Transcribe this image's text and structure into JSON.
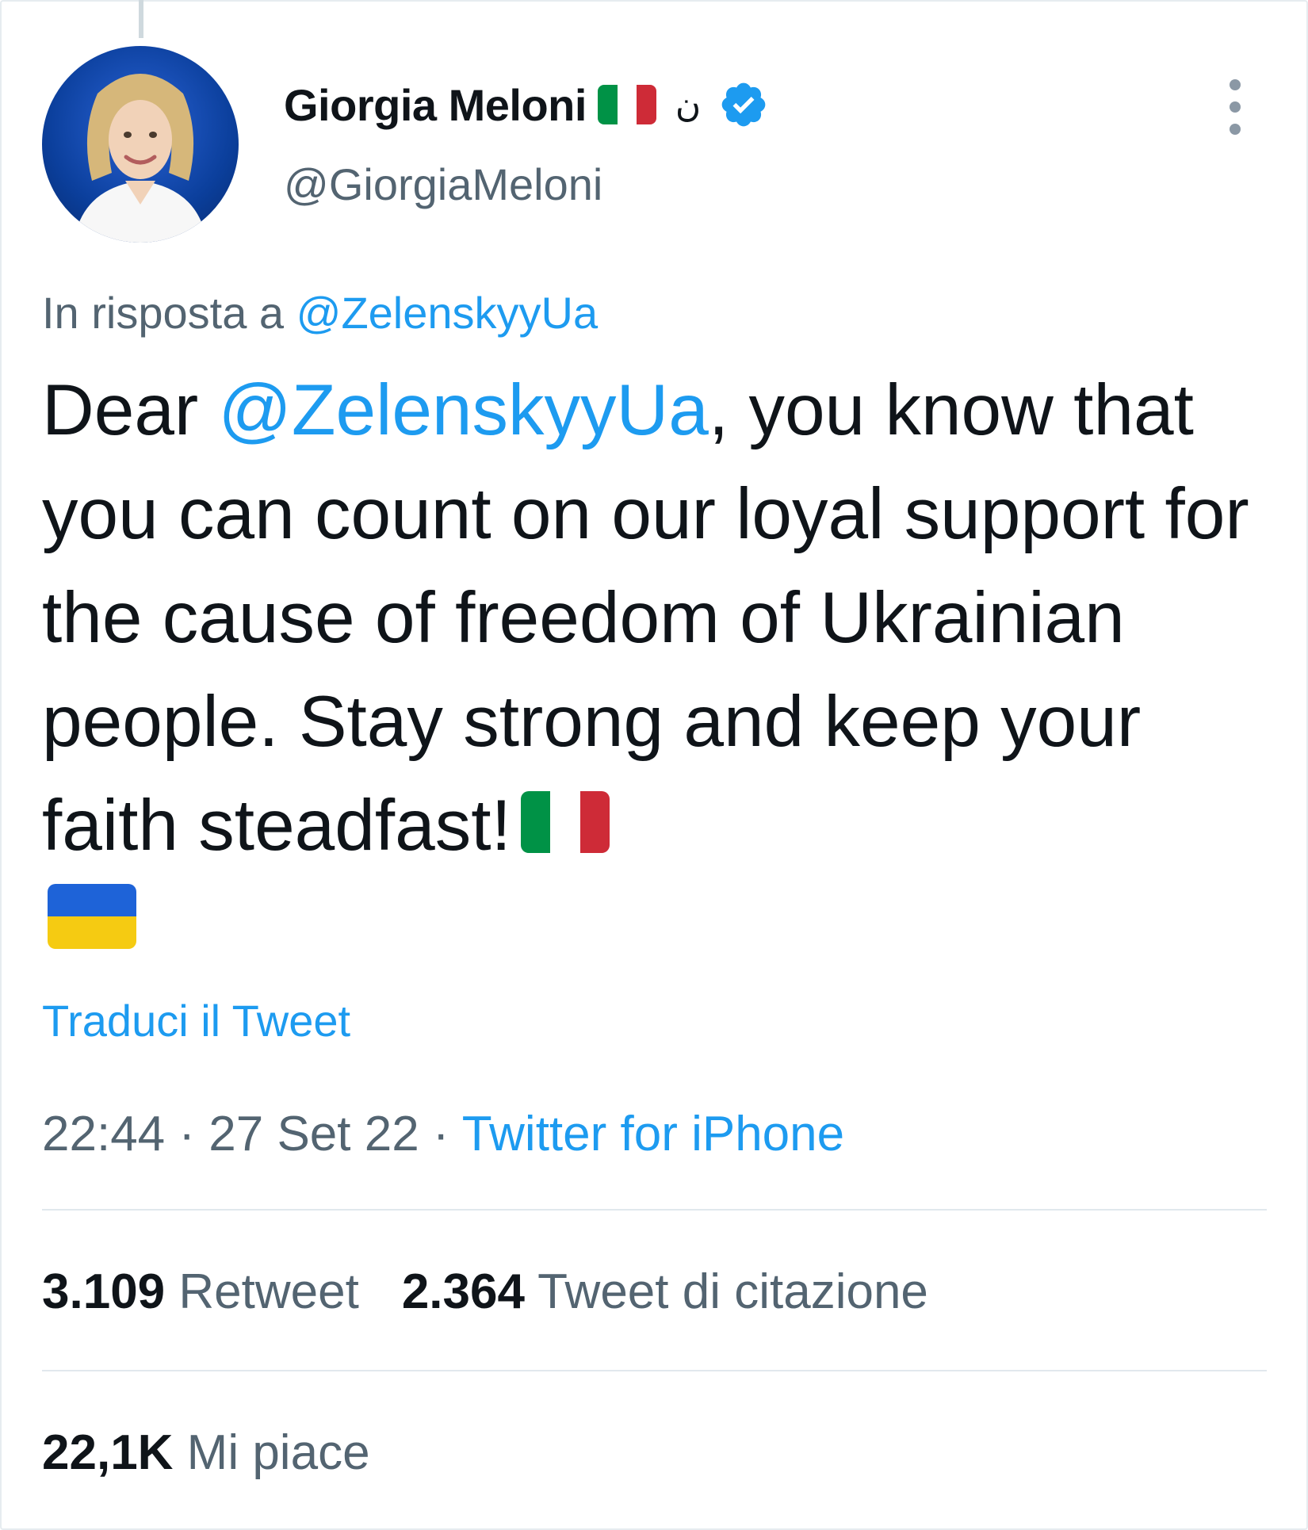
{
  "author": {
    "name": "Giorgia Meloni",
    "name_symbol": "ن",
    "handle": "@GiorgiaMeloni",
    "verified": true,
    "verified_color": "#1d9bf0"
  },
  "reply": {
    "prefix": "In risposta a ",
    "to": "@ZelenskyyUa"
  },
  "tweet": {
    "text_before": "Dear ",
    "mention": "@ZelenskyyUa",
    "text_after": ", you know that you can count on our loyal support for the cause of freedom of Ukrainian people. Stay strong and keep your faith steadfast!",
    "emojis": [
      "flag-italy-icon",
      "flag-ukraine-icon"
    ]
  },
  "translate_label": "Traduci il Tweet",
  "meta": {
    "time": "22:44",
    "sep1": " · ",
    "date": "27 Set 22",
    "sep2": " · ",
    "source": "Twitter for iPhone"
  },
  "stats": {
    "retweets_count": "3.109",
    "retweets_label": " Retweet",
    "quotes_count": "2.364",
    "quotes_label": " Tweet di citazione",
    "likes_count": "22,1K",
    "likes_label": " Mi piace"
  },
  "colors": {
    "link": "#1d9bf0",
    "secondary_text": "#536471",
    "primary_text": "#0f1419",
    "italy_green": "#009246",
    "italy_white": "#ffffff",
    "italy_red": "#ce2b37",
    "ukraine_blue": "#1e63d8",
    "ukraine_yellow": "#f5cb12"
  }
}
